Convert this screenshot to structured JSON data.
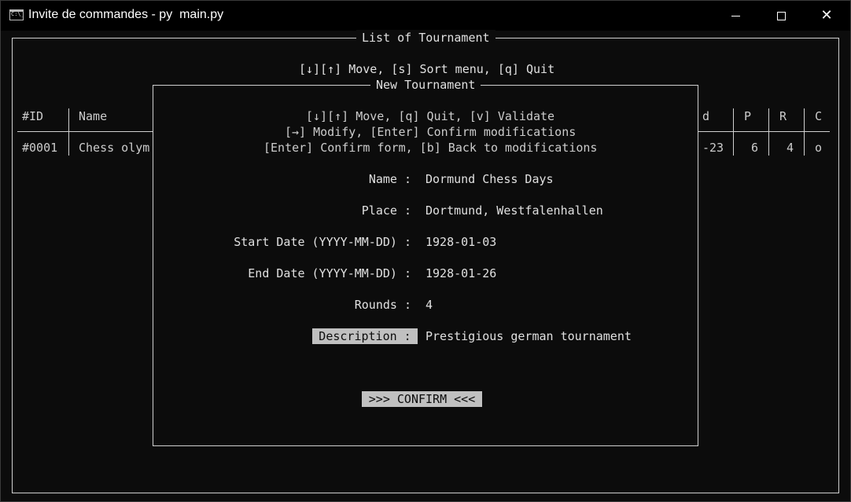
{
  "window": {
    "title": "Invite de commandes - py  main.py",
    "icon": "cmd-icon",
    "controls": [
      "minimize-icon",
      "maximize-icon",
      "close-icon"
    ]
  },
  "list_view": {
    "title": "List of Tournament",
    "help": "[↓][↑] Move, [s] Sort menu, [q] Quit",
    "columns_left": [
      "#ID",
      "Name"
    ],
    "columns_right": [
      "d",
      "P",
      "R",
      "C"
    ],
    "rows": [
      {
        "id": "#0001",
        "name": "Chess olym",
        "d": "-23",
        "p": "6",
        "r": "4",
        "c": "o"
      }
    ]
  },
  "form": {
    "title": "New Tournament",
    "help_lines": [
      "[↓][↑] Move, [q] Quit, [v] Validate",
      "[→] Modify, [Enter] Confirm modifications",
      "[Enter] Confirm form, [b] Back to modifications"
    ],
    "fields": [
      {
        "label": "Name :",
        "value": "Dormund Chess Days"
      },
      {
        "label": "Place :",
        "value": "Dortmund, Westfalenhallen"
      },
      {
        "label": "Start Date (YYYY-MM-DD) :",
        "value": "1928-01-03"
      },
      {
        "label": "End Date (YYYY-MM-DD) :",
        "value": "1928-01-26"
      },
      {
        "label": "Rounds :",
        "value": "4"
      },
      {
        "label": "Description :",
        "value": "Prestigious german tournament",
        "selected": true
      }
    ],
    "confirm_label": ">>> CONFIRM <<<"
  }
}
